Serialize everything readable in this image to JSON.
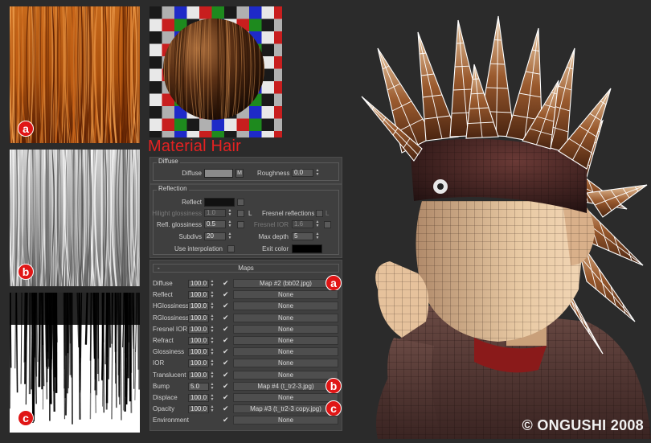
{
  "textures": [
    {
      "badge": "a",
      "desc_color": "#b0520a"
    },
    {
      "badge": "b",
      "desc_color": "#b8b8b8"
    },
    {
      "badge": "c",
      "desc_color": "#ffffff"
    }
  ],
  "material_title": "Material Hair",
  "diffuse": {
    "group_title": "Diffuse",
    "diffuse_label": "Diffuse",
    "diffuse_color": "#8a8a8a",
    "map_button": "M",
    "roughness_label": "Roughness",
    "roughness_value": "0.0"
  },
  "reflection": {
    "group_title": "Reflection",
    "reflect_label": "Reflect",
    "reflect_color": "#111111",
    "hilight_label": "Hilight glossiness",
    "hilight_value": "1.0",
    "lock_label": "L",
    "fresnel_label": "Fresnel reflections",
    "fresnel_lock": "L",
    "refl_gloss_label": "Refl. glossiness",
    "refl_gloss_value": "0.5",
    "fresnel_ior_label": "Fresnel IOR",
    "fresnel_ior_value": "1.6",
    "subdivs_label": "Subdivs",
    "subdivs_value": "20",
    "max_depth_label": "Max depth",
    "max_depth_value": "5",
    "use_interp_label": "Use interpolation",
    "exit_color_label": "Exit color",
    "exit_color": "#000000"
  },
  "maps": {
    "toggle": "-",
    "title": "Maps",
    "rows": [
      {
        "name": "Diffuse",
        "amount": "100.0",
        "checked": true,
        "map": "Map #2 (bb02.jpg)",
        "badge": "a"
      },
      {
        "name": "Reflect",
        "amount": "100.0",
        "checked": true,
        "map": "None",
        "badge": ""
      },
      {
        "name": "HGlossiness",
        "amount": "100.0",
        "checked": true,
        "map": "None",
        "badge": ""
      },
      {
        "name": "RGlossiness",
        "amount": "100.0",
        "checked": true,
        "map": "None",
        "badge": ""
      },
      {
        "name": "Fresnel IOR",
        "amount": "100.0",
        "checked": true,
        "map": "None",
        "badge": ""
      },
      {
        "name": "Refract",
        "amount": "100.0",
        "checked": true,
        "map": "None",
        "badge": ""
      },
      {
        "name": "Glossiness",
        "amount": "100.0",
        "checked": true,
        "map": "None",
        "badge": ""
      },
      {
        "name": "IOR",
        "amount": "100.0",
        "checked": true,
        "map": "None",
        "badge": ""
      },
      {
        "name": "Translucent",
        "amount": "100.0",
        "checked": true,
        "map": "None",
        "badge": ""
      },
      {
        "name": "Bump",
        "amount": "5.0",
        "checked": true,
        "map": "Map #4 (t_tr2-3.jpg)",
        "badge": "b"
      },
      {
        "name": "Displace",
        "amount": "100.0",
        "checked": true,
        "map": "None",
        "badge": ""
      },
      {
        "name": "Opacity",
        "amount": "100.0",
        "checked": true,
        "map": "Map #3 (t_tr2-3 copy.jpg)",
        "badge": "c"
      },
      {
        "name": "Environment",
        "amount": "",
        "checked": true,
        "map": "None",
        "badge": ""
      }
    ]
  },
  "copyright": "© ONGUSHI 2008",
  "colors": {
    "accent_red": "#e42222",
    "badge_red": "#e01616",
    "bg": "#2b2b2b"
  }
}
